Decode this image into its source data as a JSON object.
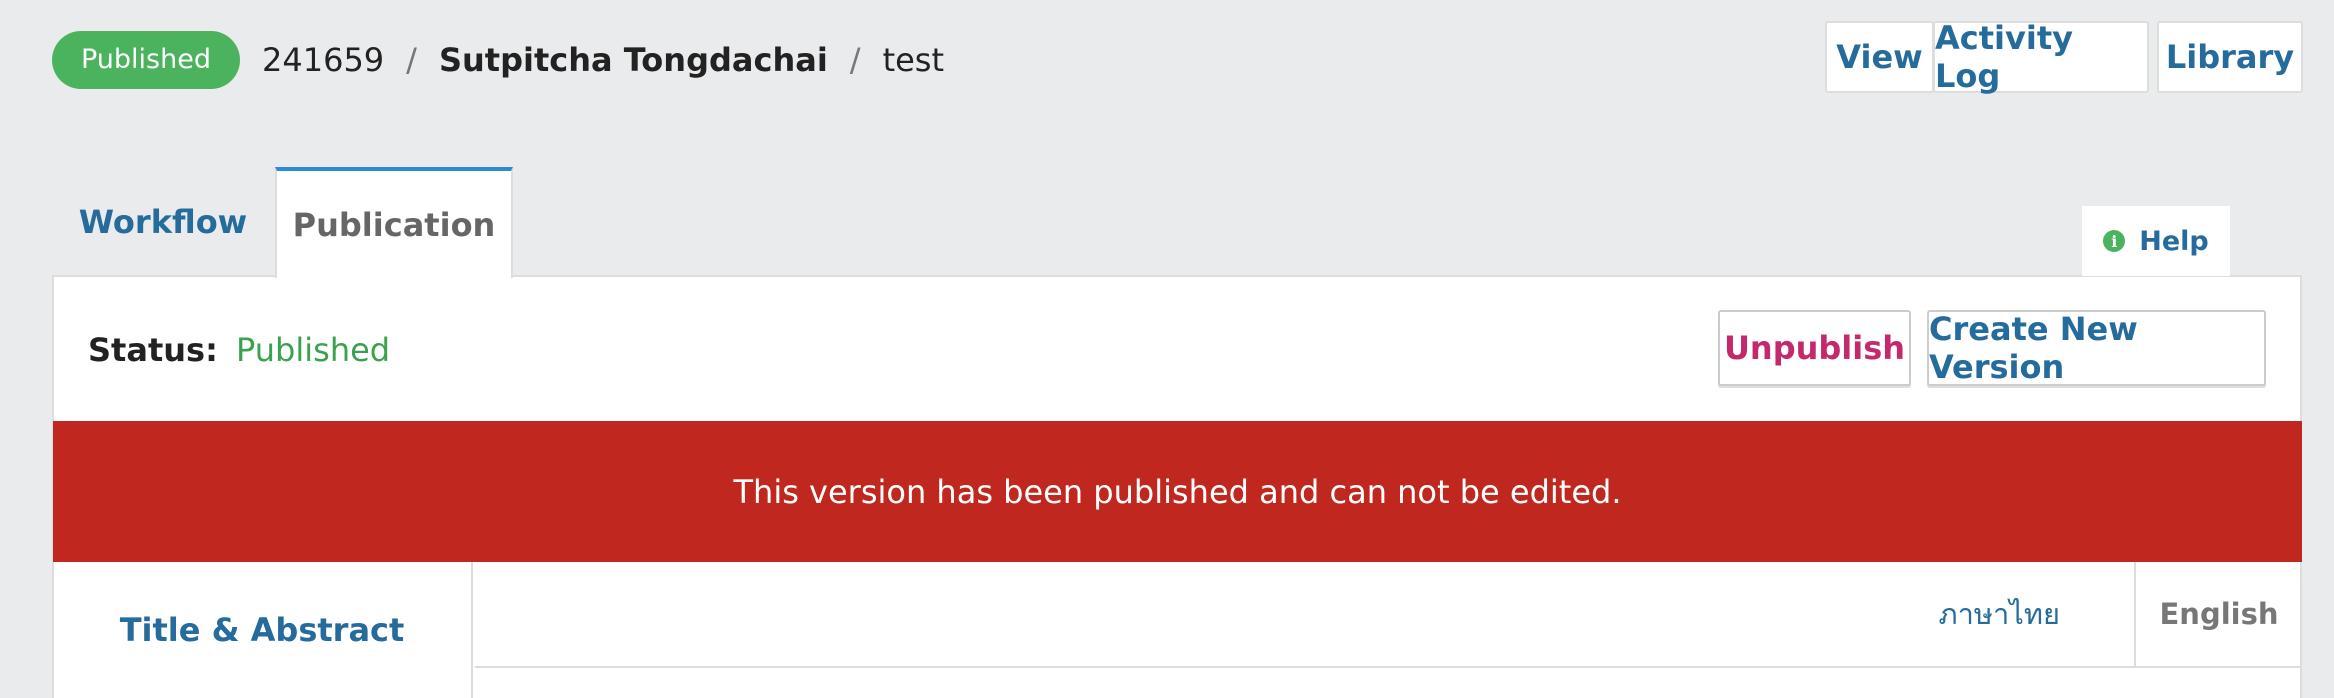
{
  "header": {
    "status_badge": "Published",
    "submission_id": "241659",
    "separator": "/",
    "author": "Sutpitcha Tongdachai",
    "title": "test"
  },
  "top_actions": {
    "view": "View",
    "activity_log": "Activity Log",
    "library": "Library"
  },
  "tabs": [
    {
      "label": "Workflow",
      "active": false
    },
    {
      "label": "Publication",
      "active": true
    }
  ],
  "help": {
    "label": "Help",
    "icon": "info-icon"
  },
  "publication": {
    "status_label": "Status:",
    "status_value": "Published",
    "unpublish": "Unpublish",
    "create_new_version": "Create New Version",
    "alert": "This version has been published and can not be edited."
  },
  "sidebar": {
    "items": [
      {
        "label": "Title & Abstract"
      }
    ]
  },
  "languages": {
    "thai": "ภาษาไทย",
    "english": "English"
  },
  "colors": {
    "published_green": "#4bb35e",
    "link_blue": "#256b9b",
    "alert_red": "#c0281f",
    "unpublish_pink": "#c42a6b"
  }
}
